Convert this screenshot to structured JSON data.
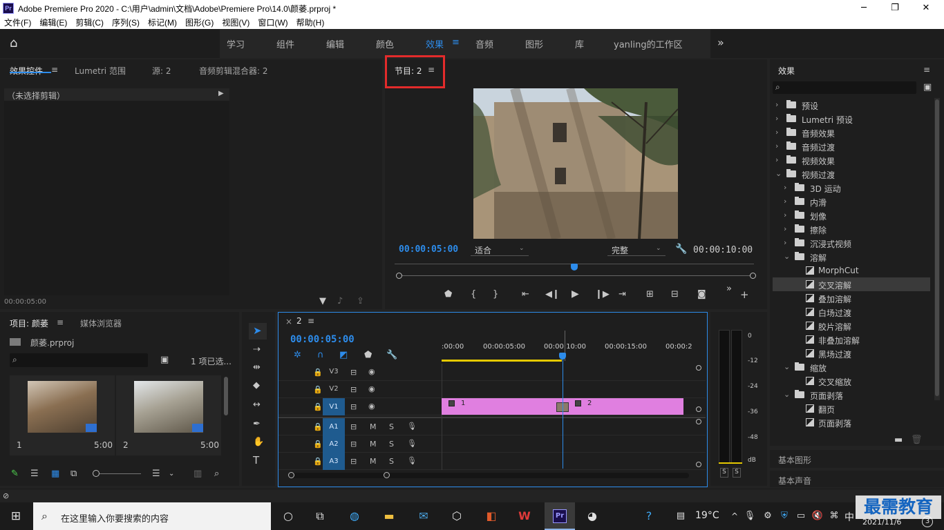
{
  "window": {
    "title": "Adobe Premiere Pro 2020 - C:\\用户\\admin\\文档\\Adobe\\Premiere Pro\\14.0\\颜萎.prproj *",
    "logo": "Pr"
  },
  "menu": [
    "文件(F)",
    "编辑(E)",
    "剪辑(C)",
    "序列(S)",
    "标记(M)",
    "图形(G)",
    "视图(V)",
    "窗口(W)",
    "帮助(H)"
  ],
  "workspaces": {
    "items": [
      "学习",
      "组件",
      "编辑",
      "颜色",
      "效果",
      "音频",
      "图形",
      "库",
      "yanling的工作区"
    ],
    "active": "效果"
  },
  "effect_controls": {
    "tabs": [
      "效果控件",
      "Lumetri 范围",
      "源: 2",
      "音频剪辑混合器: 2"
    ],
    "no_clip": "（未选择剪辑）",
    "timecode": "00:00:05:00"
  },
  "program": {
    "tab": "节目: 2",
    "timecode": "00:00:05:00",
    "fit": "适合",
    "quality": "完整",
    "duration": "00:00:10:00",
    "playhead_fraction": 0.5,
    "highlight_color": "#e32b2b"
  },
  "project": {
    "tabs": [
      "项目: 颜萎",
      "媒体浏览器"
    ],
    "file": "颜萎.prproj",
    "selected": "1 项已选...",
    "items": [
      {
        "name": "1",
        "duration": "5:00"
      },
      {
        "name": "2",
        "duration": "5:00"
      }
    ]
  },
  "timeline": {
    "tab": "2",
    "timecode": "00:00:05:00",
    "ruler": [
      ":00:00",
      "00:00:05:00",
      "00:00:10:00",
      "00:00:15:00",
      "00:00:2"
    ],
    "video_tracks": [
      "V3",
      "V2",
      "V1"
    ],
    "audio_tracks": [
      "A1",
      "A2",
      "A3"
    ],
    "clips": [
      {
        "label": "1",
        "start": 0,
        "end": 5
      },
      {
        "label": "2",
        "start": 5,
        "end": 10
      }
    ],
    "clip_color": "#e07fe0",
    "m": "M",
    "s": "S"
  },
  "meter": {
    "ticks": [
      "0",
      "-12",
      "-24",
      "-36",
      "-48",
      "dB"
    ],
    "solo": [
      "S",
      "S"
    ]
  },
  "effects": {
    "title": "效果",
    "tree": [
      {
        "label": "预设",
        "level": 0,
        "kind": "folder-star",
        "open": false
      },
      {
        "label": "Lumetri 预设",
        "level": 0,
        "kind": "folder-star",
        "open": false
      },
      {
        "label": "音频效果",
        "level": 0,
        "kind": "folder",
        "open": false
      },
      {
        "label": "音频过渡",
        "level": 0,
        "kind": "folder",
        "open": false
      },
      {
        "label": "视频效果",
        "level": 0,
        "kind": "folder",
        "open": false
      },
      {
        "label": "视频过渡",
        "level": 0,
        "kind": "folder",
        "open": true
      },
      {
        "label": "3D 运动",
        "level": 1,
        "kind": "folder",
        "open": false
      },
      {
        "label": "内滑",
        "level": 1,
        "kind": "folder",
        "open": false
      },
      {
        "label": "划像",
        "level": 1,
        "kind": "folder",
        "open": false
      },
      {
        "label": "擦除",
        "level": 1,
        "kind": "folder",
        "open": false
      },
      {
        "label": "沉浸式视频",
        "level": 1,
        "kind": "folder",
        "open": false
      },
      {
        "label": "溶解",
        "level": 1,
        "kind": "folder",
        "open": true
      },
      {
        "label": "MorphCut",
        "level": 2,
        "kind": "fx"
      },
      {
        "label": "交叉溶解",
        "level": 2,
        "kind": "fx",
        "selected": true
      },
      {
        "label": "叠加溶解",
        "level": 2,
        "kind": "fx"
      },
      {
        "label": "白场过渡",
        "level": 2,
        "kind": "fx"
      },
      {
        "label": "胶片溶解",
        "level": 2,
        "kind": "fx"
      },
      {
        "label": "非叠加溶解",
        "level": 2,
        "kind": "fx"
      },
      {
        "label": "黑场过渡",
        "level": 2,
        "kind": "fx"
      },
      {
        "label": "缩放",
        "level": 1,
        "kind": "folder",
        "open": true
      },
      {
        "label": "交叉缩放",
        "level": 2,
        "kind": "fx"
      },
      {
        "label": "页面剥落",
        "level": 1,
        "kind": "folder",
        "open": true
      },
      {
        "label": "翻页",
        "level": 2,
        "kind": "fx"
      },
      {
        "label": "页面剥落",
        "level": 2,
        "kind": "fx"
      }
    ],
    "basic_graphics": "基本图形",
    "basic_sound": "基本声音"
  },
  "taskbar": {
    "search_placeholder": "在这里输入你要搜索的内容",
    "temp": "19°C",
    "ime": "中",
    "date": "2021/11/6",
    "badge": "3"
  },
  "watermark": "最需教育"
}
